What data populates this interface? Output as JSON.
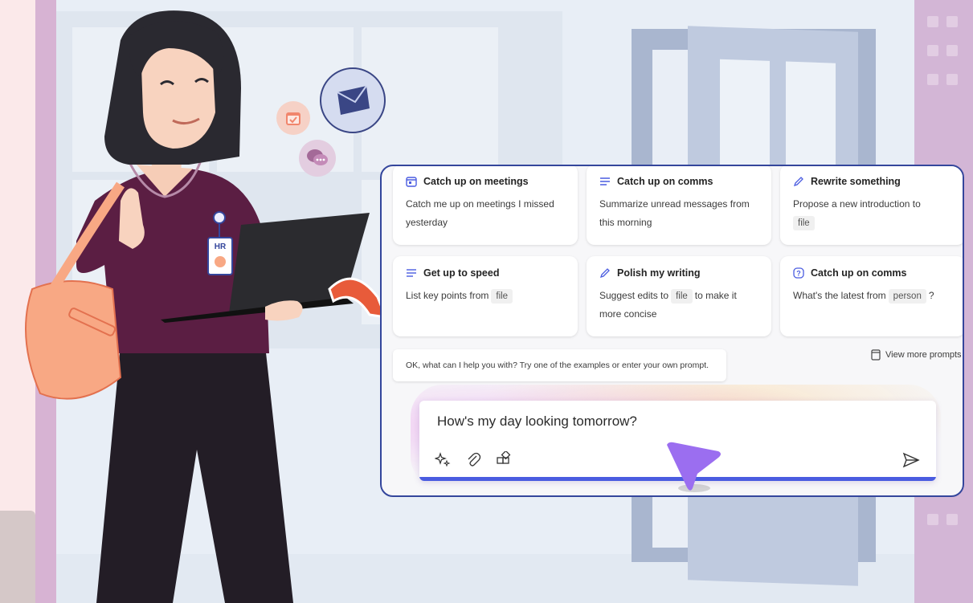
{
  "prompt_cards": [
    {
      "icon": "calendar-icon",
      "title": "Catch up on meetings",
      "body": "Catch me up on meetings I missed yesterday"
    },
    {
      "icon": "lines-icon",
      "title": "Catch up on comms",
      "body": "Summarize unread messages from this morning"
    },
    {
      "icon": "pencil-icon",
      "title": "Rewrite something",
      "body": "Propose a new introduction to",
      "chip": "file"
    },
    {
      "icon": "lines-icon",
      "title": "Get up to speed",
      "body": "List key points from",
      "chip": "file"
    },
    {
      "icon": "pencil-icon",
      "title": "Polish my writing",
      "body_pre": "Suggest edits to",
      "chip": "file",
      "body_post": "to make it more concise"
    },
    {
      "icon": "question-icon",
      "title": "Catch up on comms",
      "body": "What's the latest from",
      "chip": "person",
      "body_post": "?"
    }
  ],
  "hint_text": "OK, what can I help you with? Try one of the examples or enter your own prompt.",
  "view_more_label": "View more prompts",
  "input_text": "How's my day looking tomorrow?",
  "badge_text": "HR",
  "colors": {
    "panel_border": "#34469c",
    "accent_bar": "#4a5ce0",
    "cursor": "#9b6ef0"
  }
}
